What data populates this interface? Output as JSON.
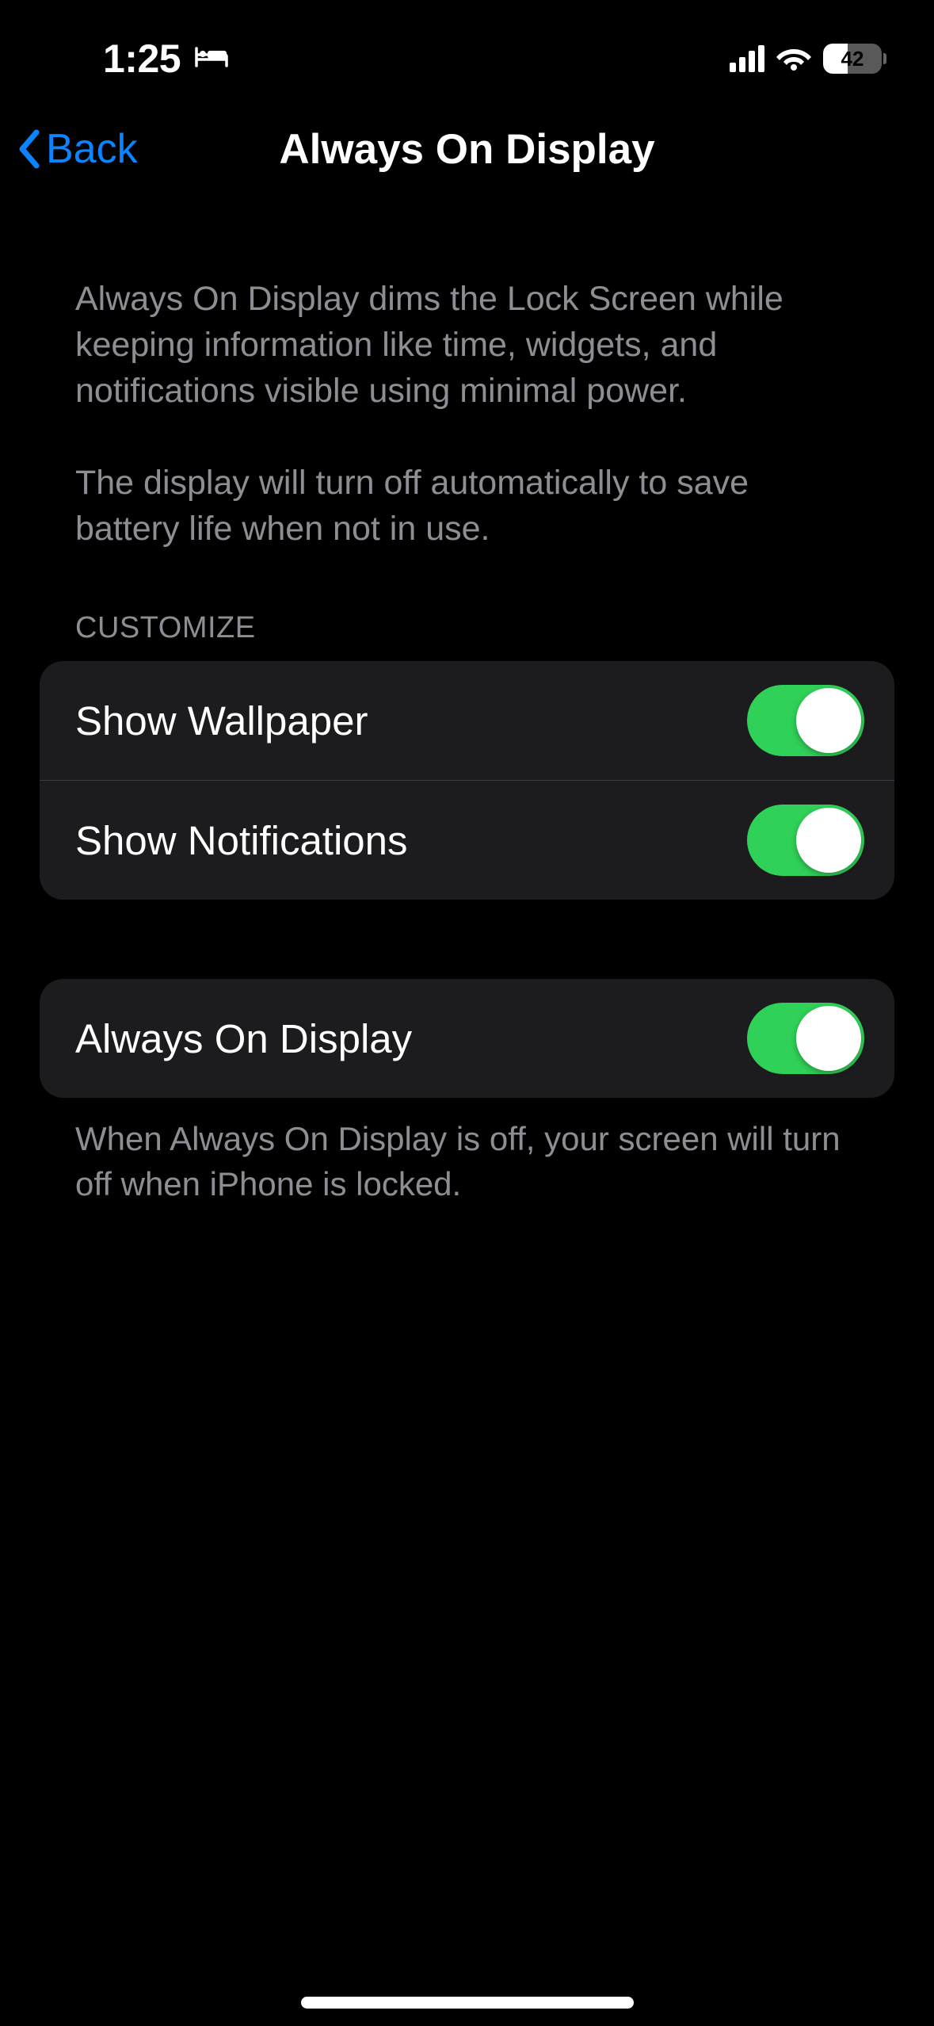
{
  "status": {
    "time": "1:25",
    "battery_percent": 42
  },
  "nav": {
    "back_label": "Back",
    "title": "Always On Display"
  },
  "description": {
    "p1": "Always On Display dims the Lock Screen while keeping information like time, widgets, and notifications visible using minimal power.",
    "p2": "The display will turn off automatically to save battery life when not in use."
  },
  "sections": {
    "customize_header": "CUSTOMIZE",
    "items": [
      {
        "label": "Show Wallpaper",
        "on": true
      },
      {
        "label": "Show Notifications",
        "on": true
      }
    ],
    "main_toggle": {
      "label": "Always On Display",
      "on": true
    },
    "footer": "When Always On Display is off, your screen will turn off when iPhone is locked."
  }
}
